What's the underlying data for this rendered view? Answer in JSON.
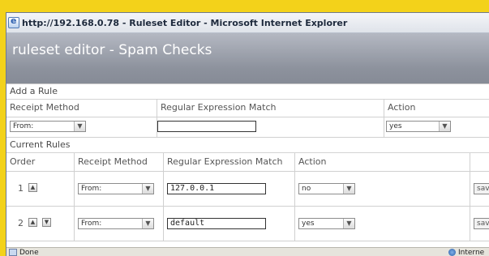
{
  "window": {
    "title": "http://192.168.0.78 - Ruleset Editor - Microsoft Internet Explorer"
  },
  "page": {
    "title": "ruleset editor - Spam Checks"
  },
  "add_rule": {
    "heading": "Add a Rule",
    "columns": [
      "Receipt Method",
      "Regular Expression Match",
      "Action"
    ],
    "method_value": "From:",
    "regex_value": "",
    "action_value": "yes"
  },
  "current_rules": {
    "heading": "Current Rules",
    "columns": [
      "Order",
      "Receipt Method",
      "Regular Expression Match",
      "Action"
    ],
    "rows": [
      {
        "order": "1",
        "method": "From:",
        "regex": "127.0.0.1",
        "action": "no",
        "save": "sav"
      },
      {
        "order": "2",
        "method": "From:",
        "regex": "default",
        "action": "yes",
        "save": "sav"
      }
    ]
  },
  "status": {
    "text": "Done",
    "zone": "Interne"
  },
  "icons": {
    "window": "ie-icon",
    "up": "arrow-up-icon",
    "down": "arrow-down-icon",
    "zone": "internet-zone-icon",
    "status": "page-icon"
  }
}
